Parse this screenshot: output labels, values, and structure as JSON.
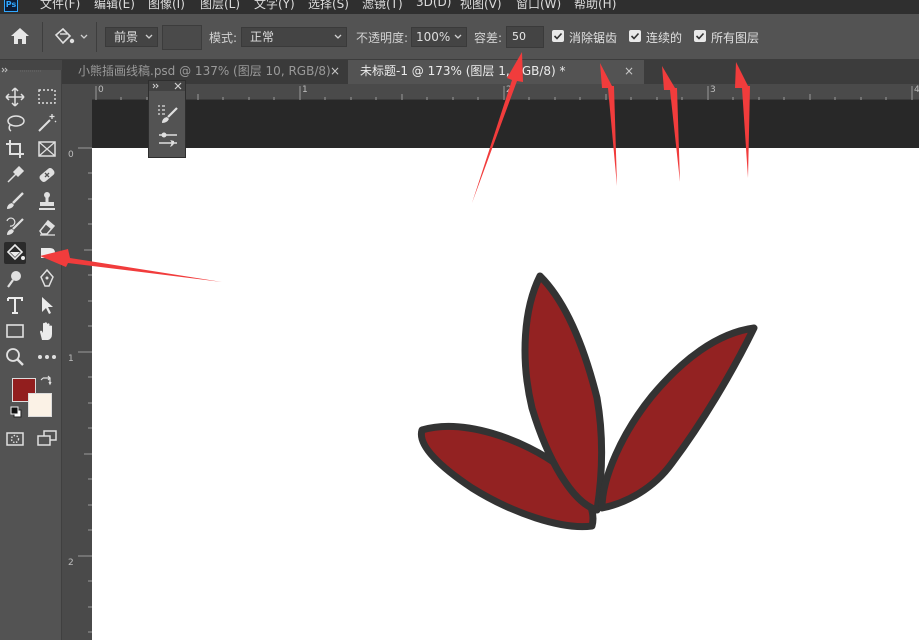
{
  "menu": {
    "logo": "Ps",
    "items": [
      "文件(F)",
      "编辑(E)",
      "图像(I)",
      "图层(L)",
      "文字(Y)",
      "选择(S)",
      "滤镜(T)",
      "3D(D)",
      "视图(V)",
      "窗口(W)",
      "帮助(H)"
    ]
  },
  "options": {
    "fill_source": "前景",
    "mode_label": "模式:",
    "mode_value": "正常",
    "opacity_label": "不透明度:",
    "opacity_value": "100%",
    "tolerance_label": "容差:",
    "tolerance_value": "50",
    "antialias_label": "消除锯齿",
    "contiguous_label": "连续的",
    "all_layers_label": "所有图层",
    "antialias_checked": true,
    "contiguous_checked": true,
    "all_layers_checked": true
  },
  "tabs": [
    {
      "label": "小熊插画线稿.psd @ 137% (图层 10, RGB/8)",
      "close": "×",
      "active": false
    },
    {
      "label": "未标题-1 @ 173% (图层 1, RGB/8) *",
      "close": "×",
      "active": true
    }
  ],
  "rulers": {
    "top_labels": [
      "0",
      "1",
      "2",
      "3",
      "4"
    ],
    "left_labels": [
      "0",
      "1",
      "2"
    ]
  },
  "colors": {
    "foreground": "#921e1e",
    "background": "#fbf2e6",
    "annotation_arrow": "#f13c3c",
    "petal_fill": "#932222",
    "petal_outline": "#333333"
  },
  "active_tool": "paint-bucket-icon"
}
